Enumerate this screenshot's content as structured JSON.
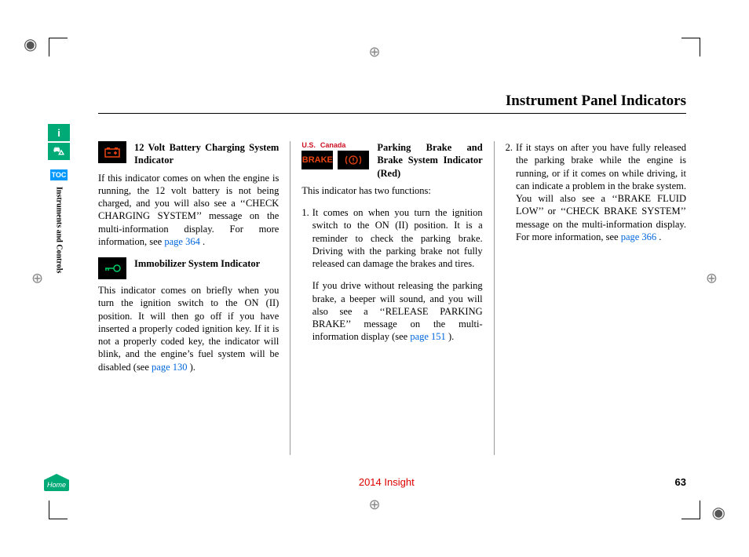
{
  "page": {
    "title": "Instrument Panel Indicators",
    "number": "63",
    "model": "2014 Insight"
  },
  "sidebar": {
    "info_icon": "i",
    "car_icon": "⛍",
    "toc_label": "TOC",
    "section_label": "Instruments and Controls",
    "home_label": "Home"
  },
  "col1": {
    "battery": {
      "title": "12 Volt Battery Charging System Indicator",
      "body": "If this indicator comes on when the engine is running, the 12 volt battery is not being charged, and you will also see a ‘‘CHECK CHARGING SYSTEM’’ message on the multi-information display. For more information, see ",
      "link": "page 364",
      "period": " ."
    },
    "immobilizer": {
      "title": "Immobilizer System Indicator",
      "body_a": "This indicator comes on briefly when you turn the ignition switch to the ON (II) position. It will then go off if you have inserted a properly coded ignition key. If it is not a properly coded key, the indicator will blink, and the engine’s fuel system will be disabled (see ",
      "link": "page 130",
      "body_b": " )."
    }
  },
  "col2": {
    "us_label": "U.S.",
    "ca_label": "Canada",
    "brake_text": "BRAKE",
    "title": "Parking Brake and Brake System Indicator (Red)",
    "intro": "This indicator has two functions:",
    "item1_num": "1.",
    "item1_body": "It comes on when you turn the ignition switch to the ON (II) position. It is a reminder to check the parking brake. Driving with the parking brake not fully released can damage the brakes and tires.",
    "item1_para2_a": "If you drive without releasing the parking brake, a beeper will sound, and you will also see a ‘‘RELEASE PARKING BRAKE’’ message on the multi-information display (see ",
    "item1_link": "page 151",
    "item1_para2_b": " )."
  },
  "col3": {
    "item2_num": "2.",
    "item2_body_a": "If it stays on after you have fully released the parking brake while the engine is running, or if it comes on while driving, it can indicate a problem in the brake system. You will also see a ‘‘BRAKE FLUID LOW’’ or ‘‘CHECK BRAKE SYSTEM’’ message on the multi-information display. For more information, see ",
    "item2_link": "page 366",
    "item2_body_b": " ."
  }
}
